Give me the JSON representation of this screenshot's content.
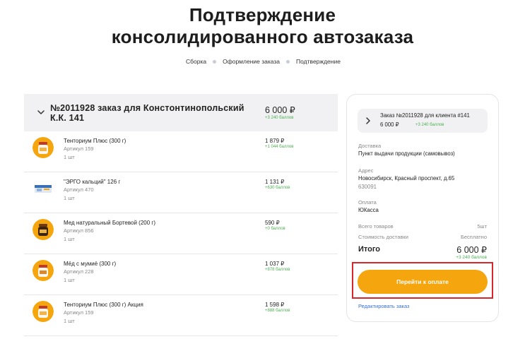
{
  "page": {
    "title_line1": "Подтверждение",
    "title_line2": "консолидированного автозаказа"
  },
  "breadcrumb": [
    "Сборка",
    "Оформление заказа",
    "Подтверждение"
  ],
  "order": {
    "title": "№2011928 заказ для Констонтинопольский К.К. 141",
    "price": "6 000 ₽",
    "points": "+3 240 баллов",
    "items": [
      {
        "name": "Тенториум Плюс (300 г)",
        "sku": "Артикул 159",
        "qty": "1 шт",
        "price": "1 879 ₽",
        "points": "+1 044 баллов",
        "icon": "honey-jar-icon"
      },
      {
        "name": "\"ЭРГО кальций\" 126 г",
        "sku": "Артикул 470",
        "qty": "1 шт",
        "price": "1 131 ₽",
        "points": "+630 баллов",
        "icon": "supplement-box-icon"
      },
      {
        "name": "Мед натуральный Бортевой (200 г)",
        "sku": "Артикул 856",
        "qty": "1 шт",
        "price": "590 ₽",
        "points": "+0 баллов",
        "icon": "honey-jar-icon"
      },
      {
        "name": "Мёд с мумиё (300 г)",
        "sku": "Артикул 228",
        "qty": "1 шт",
        "price": "1 037 ₽",
        "points": "+878 баллов",
        "icon": "honey-jar-icon"
      },
      {
        "name": "Тенториум Плюс (300 г) Акция",
        "sku": "Артикул 159",
        "qty": "1 шт",
        "price": "1 598 ₽",
        "points": "+888 баллов",
        "icon": "honey-jar-icon"
      }
    ]
  },
  "summary": {
    "sub_order_title": "Заказ №2011928 для клиента #141",
    "sub_order_price": "6 000 ₽",
    "sub_order_points": "+3 240 баллов",
    "delivery_label": "Доставка",
    "delivery_value": "Пункт выдачи продукции (самовывоз)",
    "address_label": "Адрес",
    "address_value": "Новосибирск, Красный проспект, д.65",
    "postal_code": "630091",
    "payment_label": "Оплата",
    "payment_value": "ЮКасса",
    "items_count_label": "Всего товаров",
    "items_count_value": "5шт",
    "delivery_cost_label": "Стоимость доставки",
    "delivery_cost_value": "Бесплатно",
    "total_label": "Итого",
    "total_value": "6 000 ₽",
    "total_points": "+3 240 баллов",
    "pay_button": "Перейти к оплате",
    "edit_link": "Редактировать заказ"
  },
  "colors": {
    "accent": "#f5a50d",
    "points_green": "#4caf50",
    "link_blue": "#3a6fd8",
    "highlight_red": "#d9262a"
  }
}
